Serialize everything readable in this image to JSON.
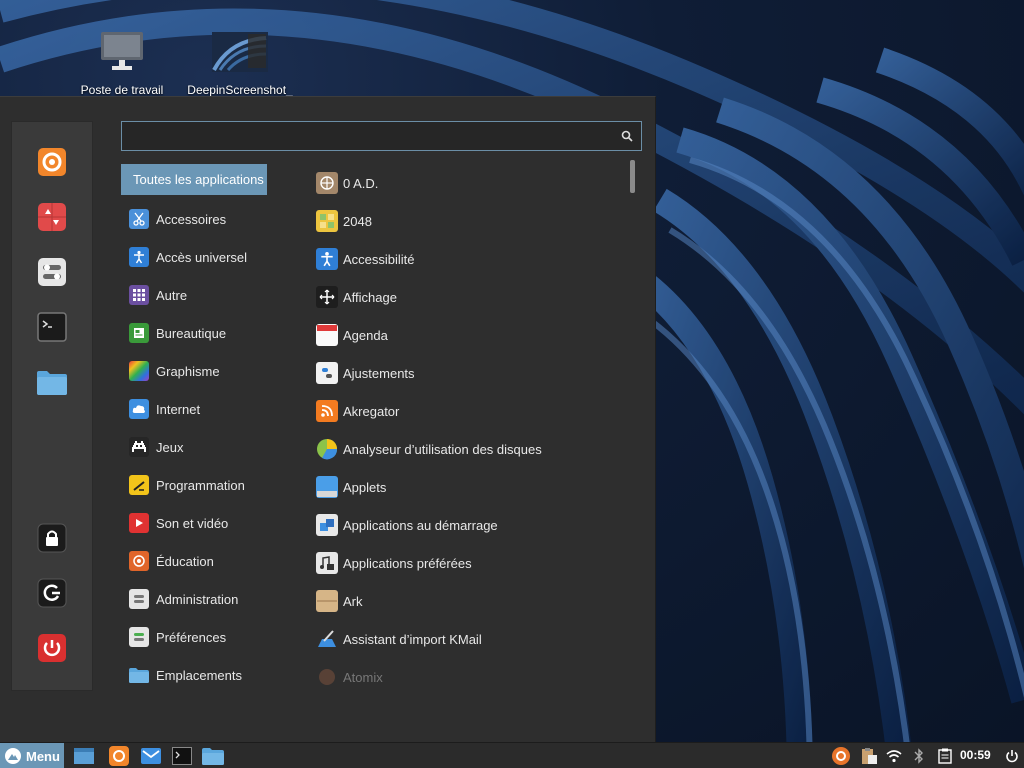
{
  "desktop": {
    "icons": [
      {
        "label": "Poste de travail"
      },
      {
        "label": "DeepinScreenshot_"
      }
    ]
  },
  "menu": {
    "search": {
      "value": "",
      "placeholder": ""
    },
    "favorites": [
      "firefox-icon",
      "software-manager-icon",
      "settings-icon",
      "terminal-icon",
      "folder-icon"
    ],
    "session": [
      "lock-icon",
      "logout-icon",
      "power-icon"
    ],
    "categories": [
      {
        "label": "Toutes les applications",
        "selected": true
      },
      {
        "label": "Accessoires",
        "icon": "scissors-icon"
      },
      {
        "label": "Accès universel",
        "icon": "accessibility-icon"
      },
      {
        "label": "Autre",
        "icon": "grid-icon"
      },
      {
        "label": "Bureautique",
        "icon": "office-icon"
      },
      {
        "label": "Graphisme",
        "icon": "graphics-icon"
      },
      {
        "label": "Internet",
        "icon": "cloud-icon"
      },
      {
        "label": "Jeux",
        "icon": "game-icon"
      },
      {
        "label": "Programmation",
        "icon": "programming-icon"
      },
      {
        "label": "Son et vidéo",
        "icon": "play-icon"
      },
      {
        "label": "Éducation",
        "icon": "education-icon"
      },
      {
        "label": "Administration",
        "icon": "admin-icon"
      },
      {
        "label": "Préférences",
        "icon": "preferences-icon"
      },
      {
        "label": "Emplacements",
        "icon": "folder-icon"
      }
    ],
    "apps": [
      {
        "label": "0 A.D."
      },
      {
        "label": "2048"
      },
      {
        "label": "Accessibilité"
      },
      {
        "label": "Affichage"
      },
      {
        "label": "Agenda"
      },
      {
        "label": "Ajustements"
      },
      {
        "label": "Akregator"
      },
      {
        "label": "Analyseur d’utilisation des disques"
      },
      {
        "label": "Applets"
      },
      {
        "label": "Applications au démarrage"
      },
      {
        "label": "Applications préférées"
      },
      {
        "label": "Ark"
      },
      {
        "label": "Assistant d’import KMail"
      },
      {
        "label": "Atomix"
      }
    ]
  },
  "taskbar": {
    "menu_label": "Menu",
    "clock": "00:59"
  },
  "colors": {
    "accent": "#6b97b6",
    "panel": "#2e2e2e",
    "taskbar": "#2b2b2b"
  }
}
